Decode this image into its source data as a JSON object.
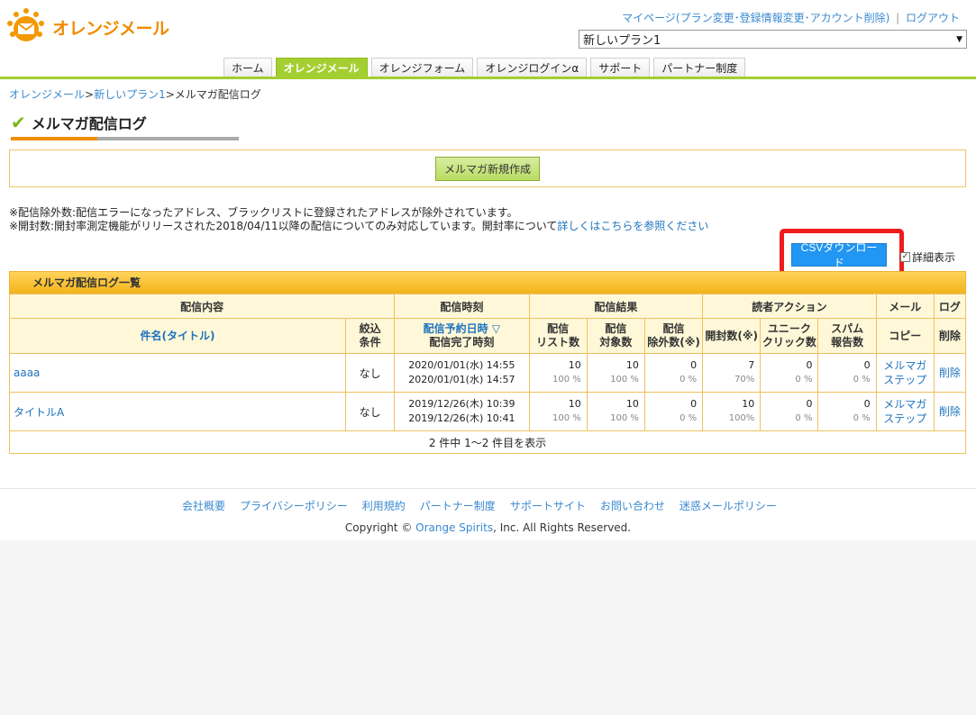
{
  "header": {
    "logo_text": "オレンジメール",
    "mypage_link": "マイページ(プラン変更･登録情報変更･アカウント削除)",
    "separator": "|",
    "logout": "ログアウト",
    "plan_selected": "新しいプラン1"
  },
  "tabs": [
    {
      "label": "ホーム",
      "active": false
    },
    {
      "label": "オレンジメール",
      "active": true
    },
    {
      "label": "オレンジフォーム",
      "active": false
    },
    {
      "label": "オレンジログインα",
      "active": false
    },
    {
      "label": "サポート",
      "active": false
    },
    {
      "label": "パートナー制度",
      "active": false
    }
  ],
  "breadcrumb": {
    "item1": "オレンジメール",
    "sep": ">",
    "item2": "新しいプラン1",
    "current": "メルマガ配信ログ"
  },
  "page_title": "メルマガ配信ログ",
  "new_button": "メルマガ新規作成",
  "notes": {
    "line1": "※配信除外数:配信エラーになったアドレス、ブラックリストに登録されたアドレスが除外されています。",
    "line2_prefix": "※開封数:開封率測定機能がリリースされた2018/04/11以降の配信についてのみ対応しています。開封率について",
    "line2_link": "詳しくはこちらを参照ください"
  },
  "csv_button": "CSVダウンロード",
  "detail_checkbox": "詳細表示",
  "list": {
    "panel_title": "メルマガ配信ログ一覧",
    "groups": [
      "配信内容",
      "配信時刻",
      "配信結果",
      "読者アクション",
      "メール",
      "ログ"
    ],
    "columns": {
      "title": "件名(タイトル)",
      "filter_1": "絞込",
      "filter_2": "条件",
      "time_1": "配信予約日時 ▽",
      "time_2": "配信完了時刻",
      "list_count_1": "配信",
      "list_count_2": "リスト数",
      "target_1": "配信",
      "target_2": "対象数",
      "excluded_1": "配信",
      "excluded_2": "除外数(※)",
      "opens": "開封数(※)",
      "unique_1": "ユニーク",
      "unique_2": "クリック数",
      "spam_1": "スパム",
      "spam_2": "報告数",
      "copy": "コピー",
      "delete": "削除"
    },
    "rows": [
      {
        "title": "aaaa",
        "filter": "なし",
        "scheduled": "2020/01/01(水) 14:55",
        "completed": "2020/01/01(水) 14:57",
        "list_count": "10",
        "list_pct": "100 %",
        "target": "10",
        "target_pct": "100 %",
        "excluded": "0",
        "excluded_pct": "0 %",
        "opens": "7",
        "opens_pct": "70%",
        "unique": "0",
        "unique_pct": "0 %",
        "spam": "0",
        "spam_pct": "0 %",
        "copy_1": "メルマガ",
        "copy_2": "ステップ",
        "delete": "削除"
      },
      {
        "title": "タイトルA",
        "filter": "なし",
        "scheduled": "2019/12/26(木) 10:39",
        "completed": "2019/12/26(木) 10:41",
        "list_count": "10",
        "list_pct": "100 %",
        "target": "10",
        "target_pct": "100 %",
        "excluded": "0",
        "excluded_pct": "0 %",
        "opens": "10",
        "opens_pct": "100%",
        "unique": "0",
        "unique_pct": "0 %",
        "spam": "0",
        "spam_pct": "0 %",
        "copy_1": "メルマガ",
        "copy_2": "ステップ",
        "delete": "削除"
      }
    ],
    "pagination": "2 件中 1〜2 件目を表示"
  },
  "footer": {
    "links": [
      "会社概要",
      "プライバシーポリシー",
      "利用規約",
      "パートナー制度",
      "サポートサイト",
      "お問い合わせ",
      "迷惑メールポリシー"
    ],
    "copyright_prefix": "Copyright © ",
    "copyright_link": "Orange Spirits",
    "copyright_suffix": ", Inc. All Rights Reserved."
  },
  "colors": {
    "accent_green": "#a4cf30",
    "accent_orange": "#f08c00",
    "csv_blue": "#2196f3",
    "highlight_red": "#ee1c1c"
  }
}
